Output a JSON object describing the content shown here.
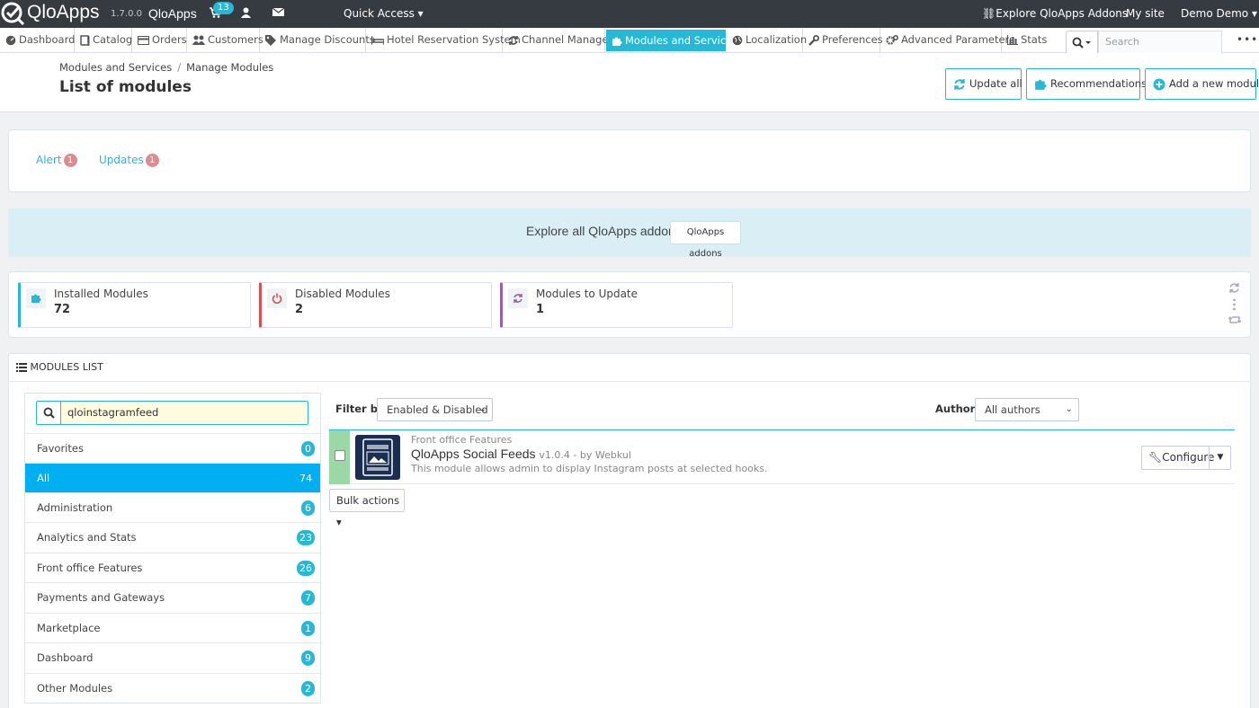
{
  "header": {
    "brand": "QloApps",
    "version": "1.7.0.0",
    "shop_name": "QloApps",
    "cart_count": "13",
    "quick_access": "Quick Access",
    "explore_addons": "Explore QloApps Addons",
    "my_site": "My site",
    "user": "Demo Demo"
  },
  "nav": {
    "items": [
      {
        "label": "Dashboard",
        "icon": "dashboard-icon"
      },
      {
        "label": "Catalog",
        "icon": "book-icon"
      },
      {
        "label": "Orders",
        "icon": "credit-card-icon"
      },
      {
        "label": "Customers",
        "icon": "users-icon"
      },
      {
        "label": "Manage Discounts",
        "icon": "tags-icon"
      },
      {
        "label": "Hotel Reservation System",
        "icon": "bed-icon"
      },
      {
        "label": "Channel Manager",
        "icon": "refresh-icon"
      },
      {
        "label": "Modules and Services",
        "icon": "puzzle-icon"
      },
      {
        "label": "Localization",
        "icon": "globe-icon"
      },
      {
        "label": "Preferences",
        "icon": "wrench-icon"
      },
      {
        "label": "Advanced Parameters",
        "icon": "cogs-icon"
      },
      {
        "label": "Stats",
        "icon": "bar-chart-icon"
      }
    ],
    "search_placeholder": "Search"
  },
  "page": {
    "breadcrumb_parent": "Modules and Services",
    "breadcrumb_current": "Manage Modules",
    "title": "List of modules",
    "buttons": {
      "update_all": "Update all",
      "recommendations": "Recommendations",
      "add_module": "Add a new module"
    }
  },
  "tabs": {
    "alert_label": "Alert",
    "alert_count": "1",
    "updates_label": "Updates",
    "updates_count": "1"
  },
  "addons": {
    "text": "Explore all QloApps addons",
    "button": "QloApps addons"
  },
  "kpis": {
    "installed_label": "Installed Modules",
    "installed_value": "72",
    "disabled_label": "Disabled Modules",
    "disabled_value": "2",
    "update_label": "Modules to Update",
    "update_value": "1"
  },
  "modules_list": {
    "heading": "Modules list",
    "search_value": "qloinstagramfeed",
    "categories": [
      {
        "label": "Favorites",
        "count": "0"
      },
      {
        "label": "All",
        "count": "74"
      },
      {
        "label": "Administration",
        "count": "6"
      },
      {
        "label": "Analytics and Stats",
        "count": "23"
      },
      {
        "label": "Front office Features",
        "count": "26"
      },
      {
        "label": "Payments and Gateways",
        "count": "7"
      },
      {
        "label": "Marketplace",
        "count": "1"
      },
      {
        "label": "Dashboard",
        "count": "9"
      },
      {
        "label": "Other Modules",
        "count": "2"
      }
    ],
    "filter_by_label": "Filter by",
    "filter_value": "Enabled & Disabled",
    "authors_label": "Authors",
    "authors_value": "All authors",
    "module": {
      "category": "Front office Features",
      "name": "QloApps Social Feeds",
      "version": "v1.0.4 - by Webkul",
      "description": "This module allows admin to display Instagram posts at selected hooks.",
      "configure": "Configure"
    },
    "bulk_actions": "Bulk actions"
  },
  "colors": {
    "accent": "#25b9d7",
    "active_category": "#00aff0",
    "header_bg": "#363a41",
    "badge_red": "#e08a8f"
  }
}
